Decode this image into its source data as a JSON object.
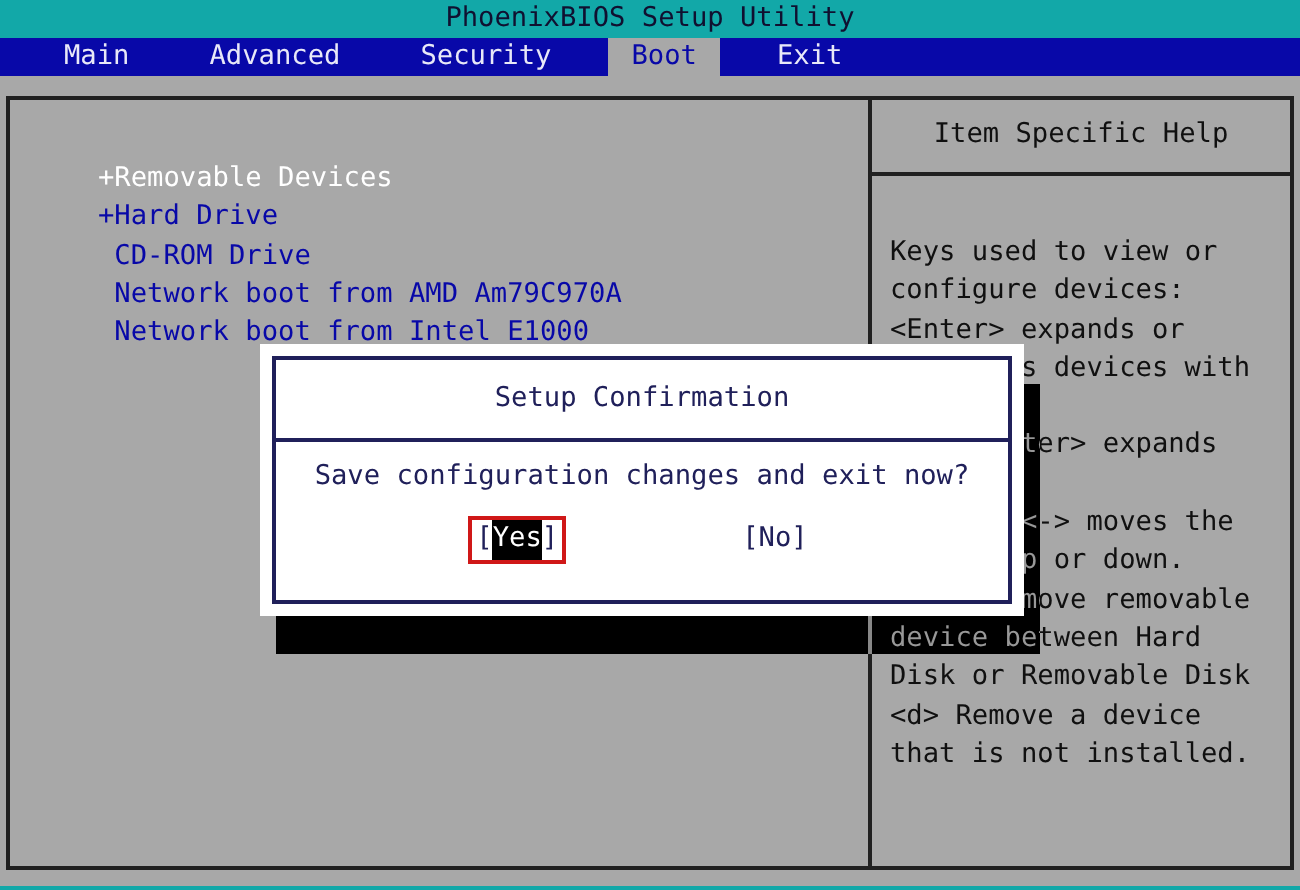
{
  "window": {
    "title": "PhoenixBIOS Setup Utility"
  },
  "tabs": [
    {
      "label": "Main",
      "selected": false
    },
    {
      "label": "Advanced",
      "selected": false
    },
    {
      "label": "Security",
      "selected": false
    },
    {
      "label": "Boot",
      "selected": true
    },
    {
      "label": "Exit",
      "selected": false
    }
  ],
  "boot_items": [
    {
      "label": "+Removable Devices",
      "kind": "group",
      "selected": true
    },
    {
      "label": "+Hard Drive",
      "kind": "group",
      "selected": false
    },
    {
      "label": "CD-ROM Drive",
      "kind": "device",
      "selected": false
    },
    {
      "label": "Network boot from AMD Am79C970A",
      "kind": "device",
      "selected": false
    },
    {
      "label": "Network boot from Intel E1000",
      "kind": "device",
      "selected": false
    }
  ],
  "help": {
    "title": "Item Specific Help",
    "lines": [
      {
        "kind": "full",
        "text": "Keys used to view or"
      },
      {
        "kind": "full",
        "text": "configure devices:"
      },
      {
        "kind": "full",
        "text": "<Enter> expands or"
      },
      {
        "kind": "cut",
        "text": "s devices with"
      },
      {
        "kind": "covered"
      },
      {
        "kind": "cut",
        "text": "ter> expands"
      },
      {
        "kind": "covered"
      },
      {
        "kind": "cut",
        "text": "<-> moves the"
      },
      {
        "kind": "cut",
        "text": "p or down."
      },
      {
        "kind": "cut",
        "text": "move removable"
      },
      {
        "kind": "full",
        "text": "device between Hard"
      },
      {
        "kind": "full",
        "text": "Disk or Removable Disk"
      },
      {
        "kind": "full",
        "text": "<d> Remove a device"
      },
      {
        "kind": "full",
        "text": "that is not installed."
      }
    ]
  },
  "dialog": {
    "title": "Setup Confirmation",
    "message": "Save configuration changes and exit now?",
    "buttons": [
      {
        "open": "[",
        "label": "Yes",
        "close": "]",
        "selected": true
      },
      {
        "open": "[",
        "label": "No",
        "close": "]",
        "selected": false
      }
    ]
  }
}
